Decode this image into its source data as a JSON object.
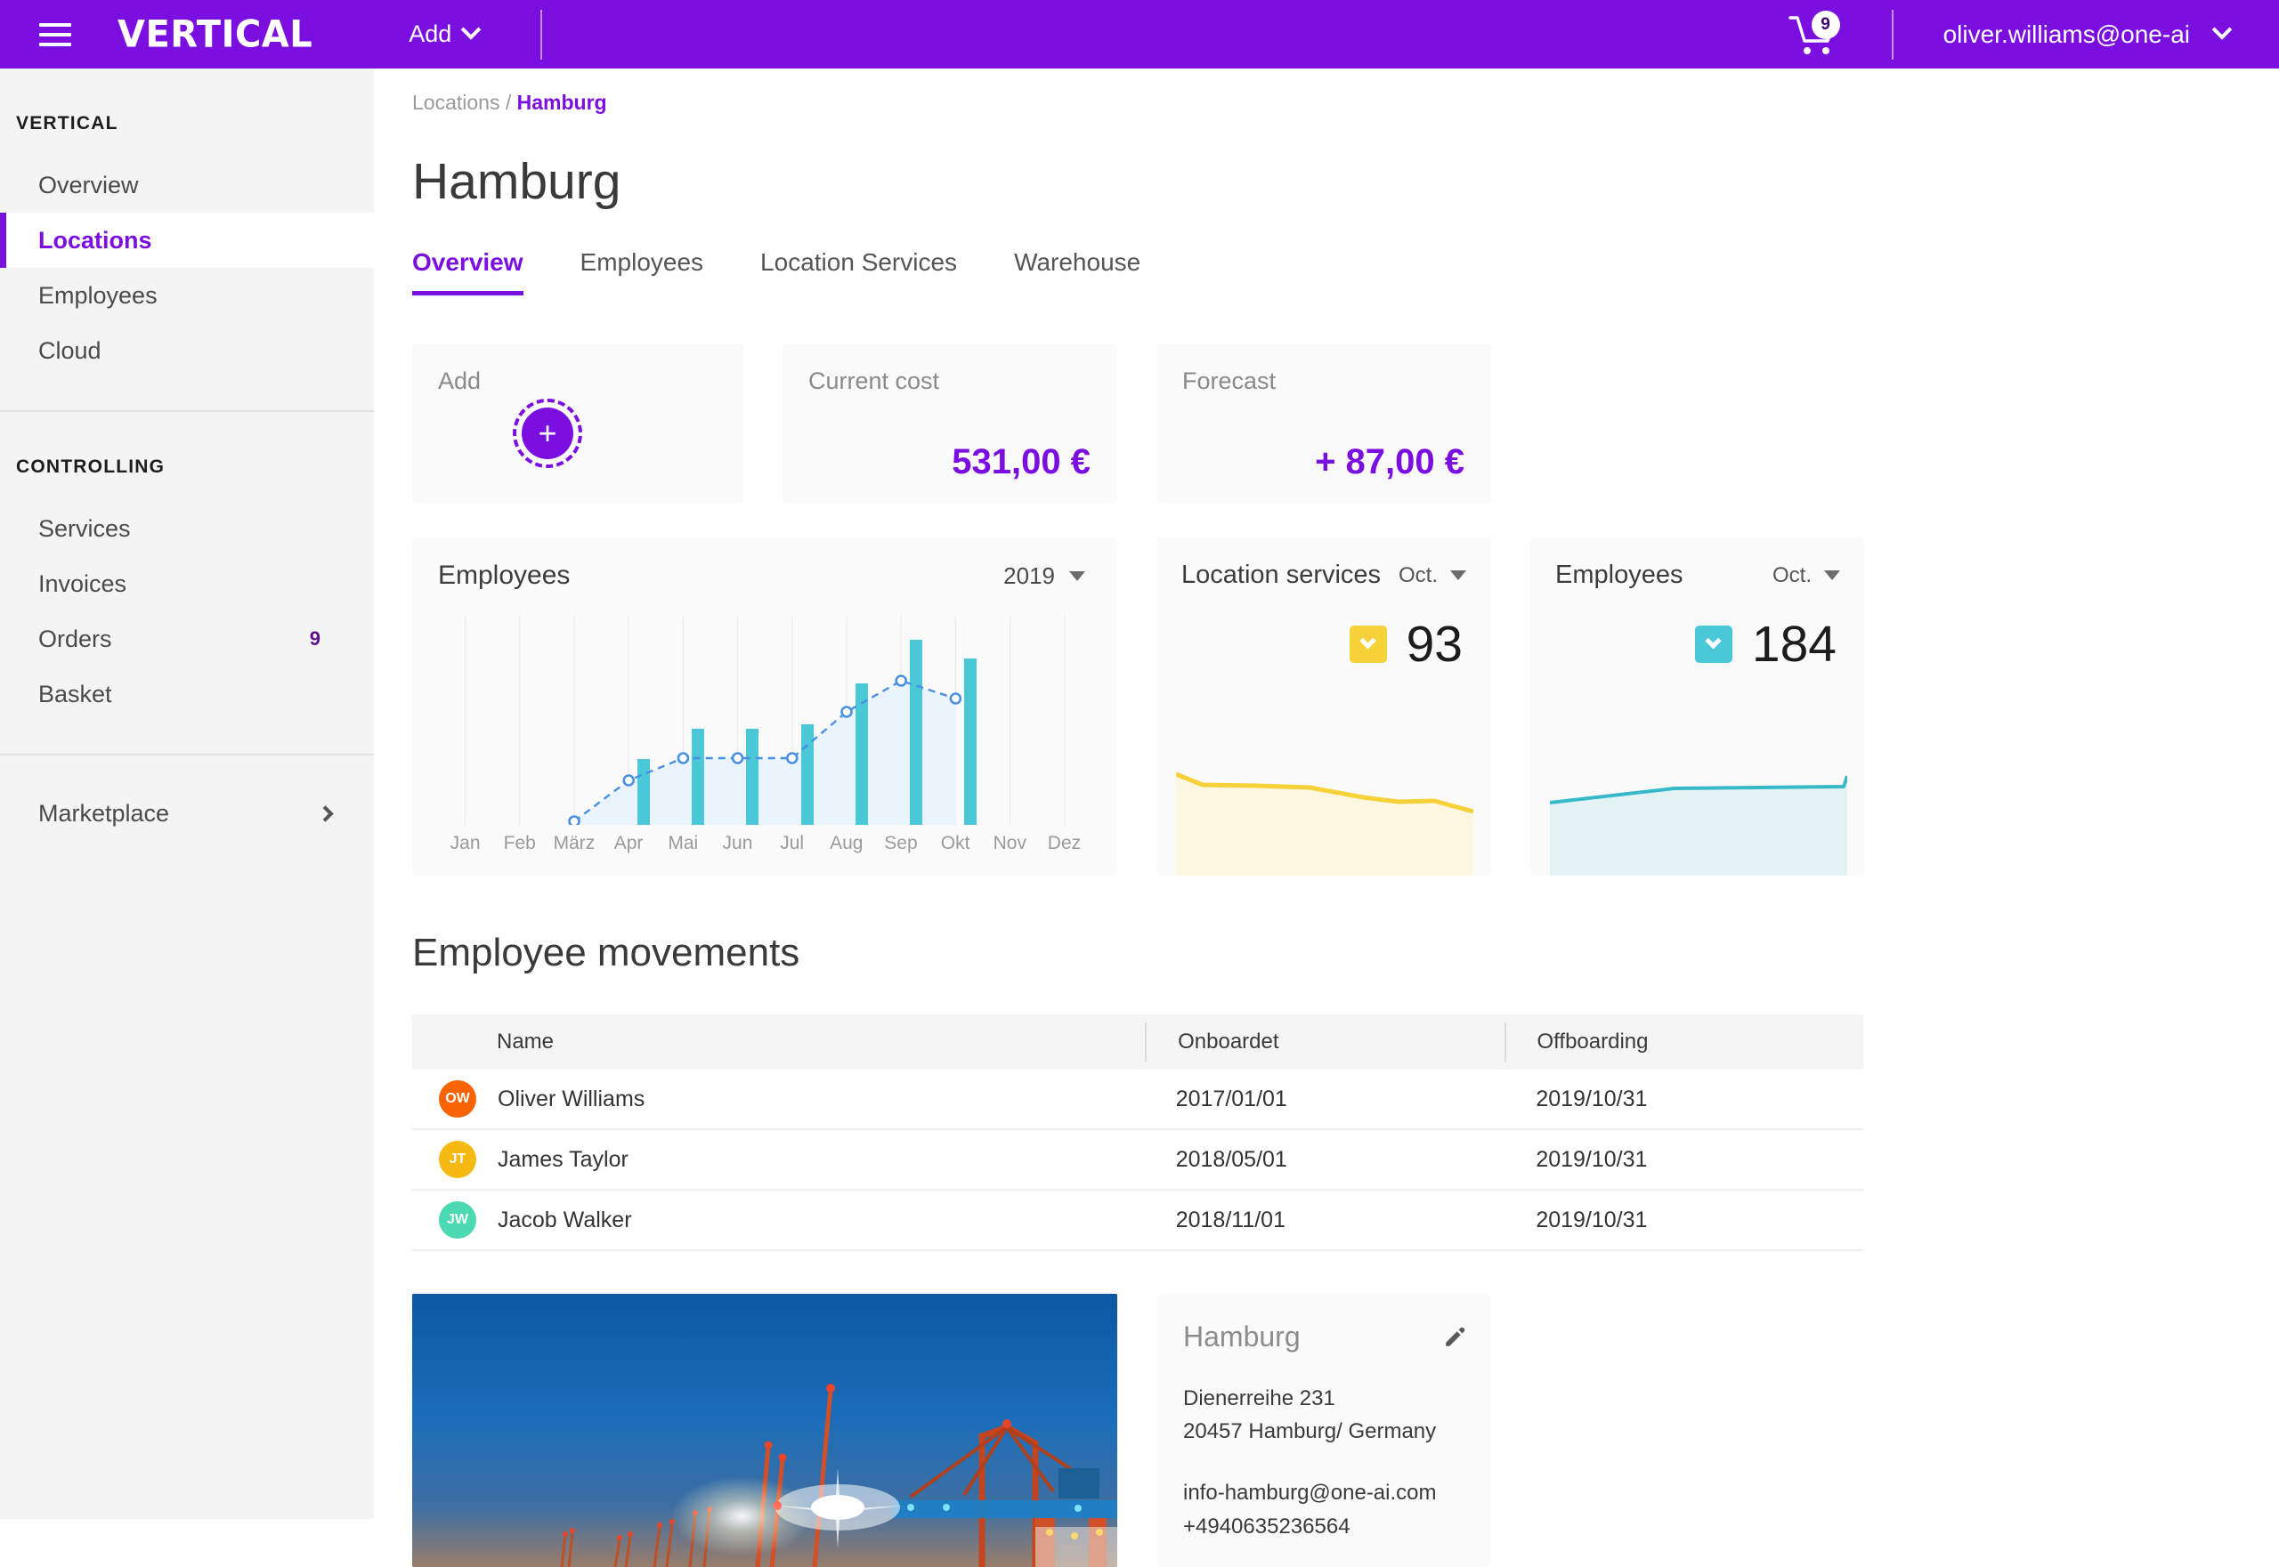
{
  "topbar": {
    "menu_icon": "hamburger-icon",
    "brand": "VERTICAL",
    "add_label": "Add",
    "cart_icon": "shopping-cart-icon",
    "cart_badge": "9",
    "user_email": "oliver.williams@one-ai"
  },
  "sidebar": {
    "groups": [
      {
        "heading": "VERTICAL",
        "items": [
          {
            "label": "Overview",
            "active": false,
            "badge": ""
          },
          {
            "label": "Locations",
            "active": true,
            "badge": ""
          },
          {
            "label": "Employees",
            "active": false,
            "badge": ""
          },
          {
            "label": "Cloud",
            "active": false,
            "badge": ""
          }
        ]
      },
      {
        "heading": "CONTROLLING",
        "items": [
          {
            "label": "Services",
            "active": false,
            "badge": ""
          },
          {
            "label": "Invoices",
            "active": false,
            "badge": ""
          },
          {
            "label": "Orders",
            "active": false,
            "badge": "9"
          },
          {
            "label": "Basket",
            "active": false,
            "badge": ""
          }
        ]
      }
    ],
    "marketplace": {
      "label": "Marketplace",
      "arrow_icon": "chevron-right-icon"
    }
  },
  "breadcrumb": {
    "root": "Locations",
    "separator": "/",
    "current": "Hamburg"
  },
  "page_title": "Hamburg",
  "tabs": [
    {
      "label": "Overview",
      "active": true
    },
    {
      "label": "Employees",
      "active": false
    },
    {
      "label": "Location Services",
      "active": false
    },
    {
      "label": "Warehouse",
      "active": false
    }
  ],
  "cards": {
    "add": {
      "label": "Add",
      "icon": "plus-icon"
    },
    "current_cost": {
      "label": "Current cost",
      "value": "531,00 €"
    },
    "forecast": {
      "label": "Forecast",
      "value": "+ 87,00 €"
    }
  },
  "employees_chart": {
    "title": "Employees",
    "year_selector": "2019"
  },
  "location_services_card": {
    "title": "Location services",
    "period": "Oct.",
    "value": "93",
    "chip_icon": "chevron-down-icon",
    "accent_color": "#F7D138"
  },
  "employees_card": {
    "title": "Employees",
    "period": "Oct.",
    "value": "184",
    "chip_icon": "chevron-down-icon",
    "accent_color": "#4BC8D8"
  },
  "movements": {
    "title": "Employee movements",
    "columns": [
      "Name",
      "Onboardet",
      "Offboarding"
    ],
    "rows": [
      {
        "initials": "OW",
        "color": "#F96302",
        "name": "Oliver Williams",
        "onboarded": "2017/01/01",
        "offboarding": "2019/10/31"
      },
      {
        "initials": "JT",
        "color": "#F5B913",
        "name": "James Taylor",
        "onboarded": "2018/05/01",
        "offboarding": "2019/10/31"
      },
      {
        "initials": "JW",
        "color": "#4AD9B0",
        "name": "Jacob Walker",
        "onboarded": "2018/11/01",
        "offboarding": "2019/10/31"
      }
    ]
  },
  "location_photo": {
    "alt": "hamburg-harbour-cranes-photo"
  },
  "address_card": {
    "title": "Hamburg",
    "edit_icon": "pencil-icon",
    "street": "Dienerreihe 231",
    "city": "20457 Hamburg/ Germany",
    "email": "info-hamburg@one-ai.com",
    "phone": "+4940635236564"
  },
  "chart_data": {
    "type": "bar",
    "title": "Employees",
    "xlabel": "",
    "ylabel": "",
    "categories": [
      "Jan",
      "Feb",
      "März",
      "Apr",
      "Mai",
      "Jun",
      "Jul",
      "Aug",
      "Sep",
      "Okt",
      "Nov",
      "Dez"
    ],
    "ylim": [
      0,
      200
    ],
    "grid": true,
    "legend": null,
    "series": [
      {
        "name": "Employees (bars)",
        "type": "bar",
        "values": [
          null,
          null,
          null,
          62,
          92,
          92,
          96,
          135,
          178,
          160,
          null,
          null
        ]
      },
      {
        "name": "Trend (dashed line)",
        "type": "line",
        "values": [
          null,
          null,
          4,
          46,
          72,
          72,
          72,
          118,
          152,
          133,
          null,
          null
        ]
      }
    ]
  },
  "sparkline_data": [
    {
      "type": "area",
      "title": "Location services",
      "color": "#F7D138",
      "values": [
        93,
        86,
        86,
        86,
        85,
        84,
        82,
        80,
        79,
        79,
        78,
        72
      ]
    },
    {
      "type": "area",
      "title": "Employees",
      "color": "#4BC8D8",
      "values": [
        160,
        166,
        172,
        178,
        179,
        180,
        181,
        182,
        183,
        183,
        184,
        192
      ]
    }
  ]
}
